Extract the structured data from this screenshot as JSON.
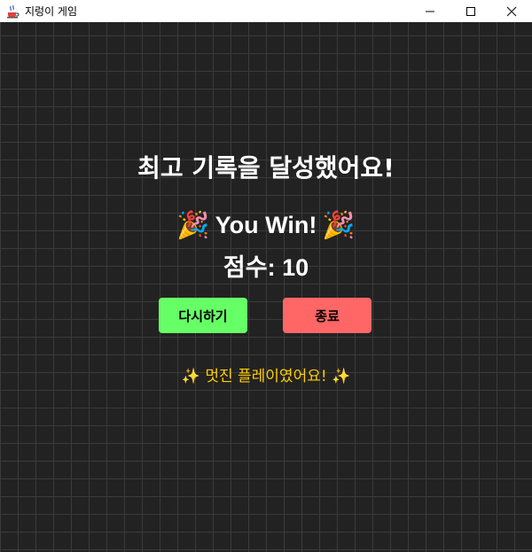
{
  "window": {
    "title": "지렁이 게임",
    "icon": "java-cup-icon"
  },
  "controls": {
    "minimize": "minimize-icon",
    "maximize": "maximize-icon",
    "close": "close-icon"
  },
  "game": {
    "headline": "최고 기록을 달성했어요!",
    "win_text": "You Win!",
    "win_emoji": "🎉",
    "score_text": "점수: 10",
    "retry_label": "다시하기",
    "quit_label": "종료",
    "praise": "✨ 멋진 플레이였어요! ✨",
    "colors": {
      "background": "#222222",
      "grid": "#3a3a3a",
      "retry_button": "#66ff66",
      "quit_button": "#ff6666",
      "praise_text": "#ffcc00"
    }
  }
}
